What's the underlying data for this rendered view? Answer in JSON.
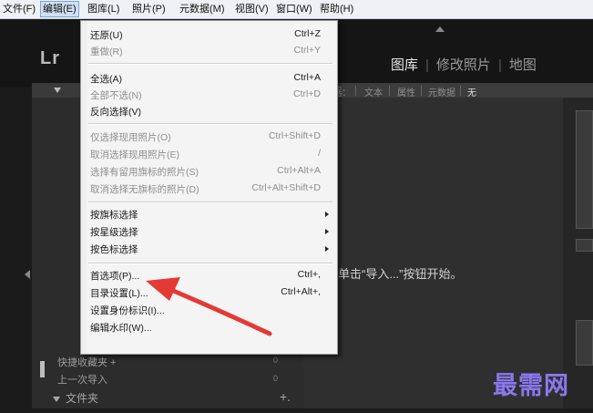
{
  "menubar": {
    "items": [
      {
        "label": "文件(F)"
      },
      {
        "label": "编辑(E)"
      },
      {
        "label": "图库(L)"
      },
      {
        "label": "照片(P)"
      },
      {
        "label": "元数据(M)"
      },
      {
        "label": "视图(V)"
      },
      {
        "label": "窗口(W)"
      },
      {
        "label": "帮助(H)"
      }
    ]
  },
  "app": {
    "logo": "Lr",
    "modules": [
      "图库",
      "修改照片",
      "地图"
    ],
    "filter": {
      "label": "过滤器:",
      "options": [
        "文本",
        "属性",
        "元数据",
        "无"
      ]
    },
    "empty_message": "单击“导入...”按钮开始。",
    "left_panel": {
      "rows": [
        {
          "label": "快捷收藏夹 +",
          "count": "0"
        },
        {
          "label": "上一次导入",
          "count": "0"
        }
      ],
      "folders_label": "文件夹",
      "folders_add": "+."
    },
    "watermark": "最需网"
  },
  "edit_menu": {
    "items": [
      {
        "label": "还原(U)",
        "shortcut": "Ctrl+Z",
        "enabled": true
      },
      {
        "label": "重做(R)",
        "shortcut": "Ctrl+Y",
        "enabled": false
      },
      {
        "label": "全选(A)",
        "shortcut": "Ctrl+A",
        "enabled": true
      },
      {
        "label": "全部不选(N)",
        "shortcut": "Ctrl+D",
        "enabled": false
      },
      {
        "label": "反向选择(V)",
        "shortcut": "",
        "enabled": true
      },
      {
        "label": "仅选择现用照片(O)",
        "shortcut": "Ctrl+Shift+D",
        "enabled": false
      },
      {
        "label": "取消选择现用照片(E)",
        "shortcut": "/",
        "enabled": false
      },
      {
        "label": "选择有留用旗标的照片(S)",
        "shortcut": "Ctrl+Alt+A",
        "enabled": false
      },
      {
        "label": "取消选择无旗标的照片(D)",
        "shortcut": "Ctrl+Alt+Shift+D",
        "enabled": false
      },
      {
        "label": "按旗标选择",
        "shortcut": "",
        "enabled": true,
        "submenu": true
      },
      {
        "label": "按星级选择",
        "shortcut": "",
        "enabled": true,
        "submenu": true
      },
      {
        "label": "按色标选择",
        "shortcut": "",
        "enabled": true,
        "submenu": true
      },
      {
        "label": "首选项(P)...",
        "shortcut": "Ctrl+,",
        "enabled": true
      },
      {
        "label": "目录设置(L)...",
        "shortcut": "Ctrl+Alt+,",
        "enabled": true
      },
      {
        "label": "设置身份标识(I)...",
        "shortcut": "",
        "enabled": true
      },
      {
        "label": "编辑水印(W)...",
        "shortcut": "",
        "enabled": true
      }
    ]
  },
  "colors": {
    "annotation_arrow": "#e53935",
    "watermark": "#8b77ee"
  }
}
